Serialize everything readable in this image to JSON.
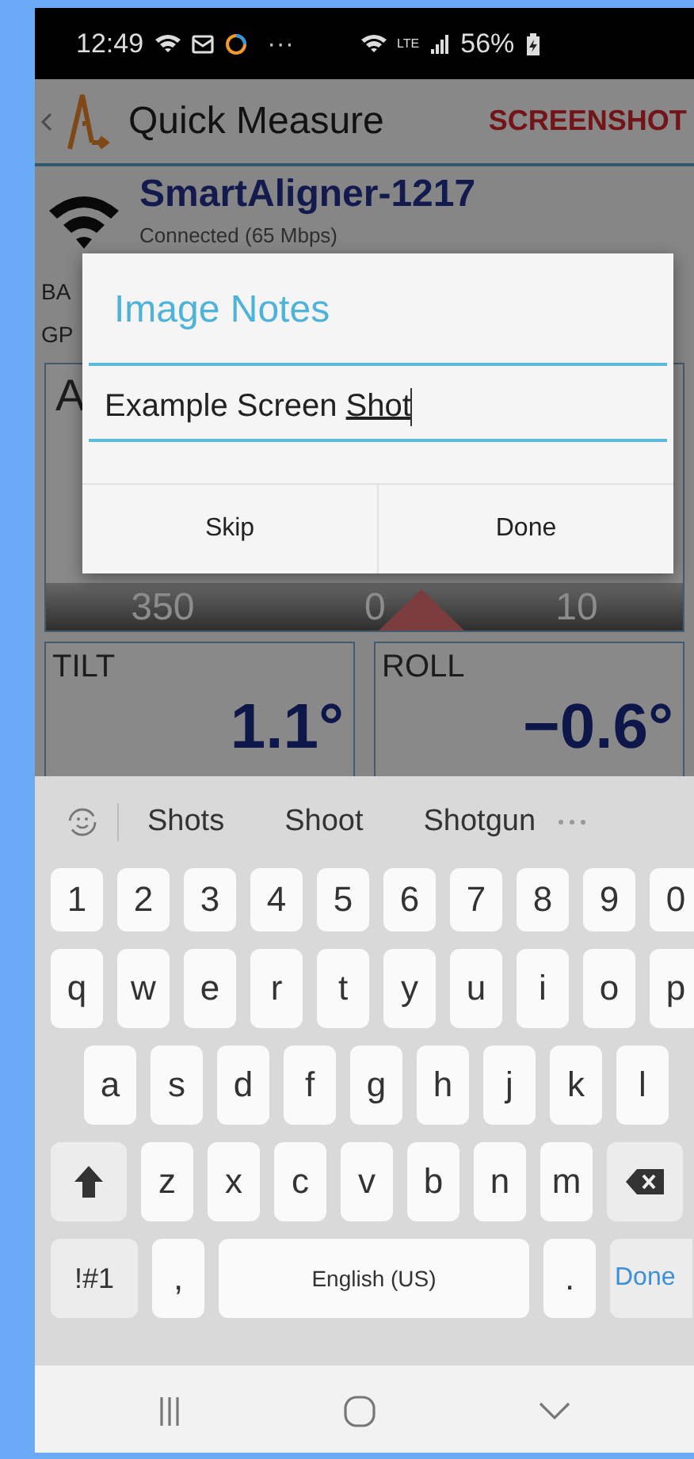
{
  "status_bar": {
    "time": "12:49",
    "more": "···",
    "network": "LTE",
    "battery": "56%"
  },
  "app_bar": {
    "title": "Quick Measure",
    "action": "SCREENSHOT"
  },
  "device": {
    "name": "SmartAligner-1217",
    "status": "Connected  (65 Mbps)"
  },
  "info_rows": [
    "BA",
    "GP"
  ],
  "azimuth_panel": {
    "label": "A",
    "scale": [
      "350",
      "0",
      "10"
    ]
  },
  "gauges": [
    {
      "label": "TILT",
      "value": "1.1°"
    },
    {
      "label": "ROLL",
      "value": "−0.6°"
    }
  ],
  "dialog": {
    "title": "Image Notes",
    "value": "Example Screen ",
    "composing": "Shot",
    "buttons": [
      "Skip",
      "Done"
    ]
  },
  "keyboard": {
    "suggestions": [
      "Shots",
      "Shoot",
      "Shotgun"
    ],
    "rows": [
      {
        "keys": [
          {
            "kind": "char",
            "label": "1"
          },
          {
            "kind": "char",
            "label": "2"
          },
          {
            "kind": "char",
            "label": "3"
          },
          {
            "kind": "char",
            "label": "4"
          },
          {
            "kind": "char",
            "label": "5"
          },
          {
            "kind": "char",
            "label": "6"
          },
          {
            "kind": "char",
            "label": "7"
          },
          {
            "kind": "char",
            "label": "8"
          },
          {
            "kind": "char",
            "label": "9"
          },
          {
            "kind": "char",
            "label": "0"
          }
        ]
      },
      {
        "keys": [
          {
            "kind": "char",
            "label": "q"
          },
          {
            "kind": "char",
            "label": "w"
          },
          {
            "kind": "char",
            "label": "e"
          },
          {
            "kind": "char",
            "label": "r"
          },
          {
            "kind": "char",
            "label": "t"
          },
          {
            "kind": "char",
            "label": "y"
          },
          {
            "kind": "char",
            "label": "u"
          },
          {
            "kind": "char",
            "label": "i"
          },
          {
            "kind": "char",
            "label": "o"
          },
          {
            "kind": "char",
            "label": "p"
          }
        ]
      },
      {
        "keys": [
          {
            "kind": "char",
            "label": "a"
          },
          {
            "kind": "char",
            "label": "s"
          },
          {
            "kind": "char",
            "label": "d"
          },
          {
            "kind": "char",
            "label": "f"
          },
          {
            "kind": "char",
            "label": "g"
          },
          {
            "kind": "char",
            "label": "h"
          },
          {
            "kind": "char",
            "label": "j"
          },
          {
            "kind": "char",
            "label": "k"
          },
          {
            "kind": "char",
            "label": "l"
          }
        ]
      },
      {
        "keys": [
          {
            "kind": "shift"
          },
          {
            "kind": "char",
            "label": "z"
          },
          {
            "kind": "char",
            "label": "x"
          },
          {
            "kind": "char",
            "label": "c"
          },
          {
            "kind": "char",
            "label": "v"
          },
          {
            "kind": "char",
            "label": "b"
          },
          {
            "kind": "char",
            "label": "n"
          },
          {
            "kind": "char",
            "label": "m"
          },
          {
            "kind": "backspace"
          }
        ]
      },
      {
        "keys": [
          {
            "kind": "mode",
            "label": "!#1"
          },
          {
            "kind": "char",
            "label": ","
          },
          {
            "kind": "space",
            "label": "English (US)"
          },
          {
            "kind": "char",
            "label": "."
          },
          {
            "kind": "action",
            "label": "Done"
          }
        ]
      }
    ]
  }
}
